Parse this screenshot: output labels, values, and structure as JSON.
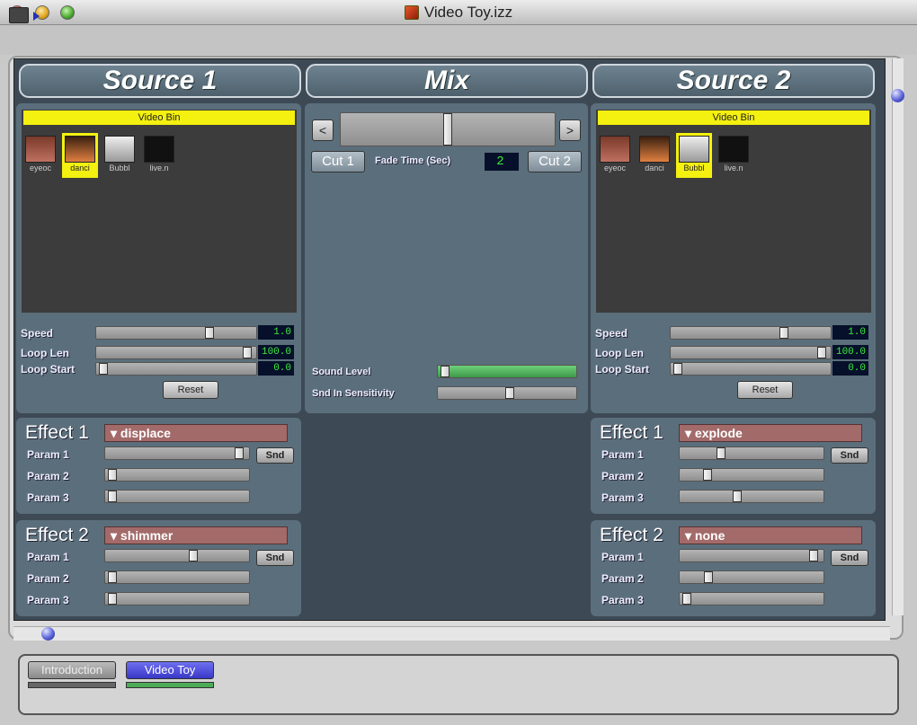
{
  "window": {
    "title": "Video Toy.izz"
  },
  "sources": [
    {
      "header": "Source 1",
      "bin_label": "Video Bin",
      "clips": [
        {
          "name": "eyeoc",
          "sel": false
        },
        {
          "name": "danci",
          "sel": true
        },
        {
          "name": "Bubbl",
          "sel": false
        },
        {
          "name": "live.n",
          "sel": false
        }
      ],
      "speed_label": "Speed",
      "speed_value": "1.0",
      "speed_level": 0.72,
      "looplen_label": "Loop Len",
      "looplen_value": "100.0",
      "looplen_level": 0.97,
      "loopstart_label": "Loop Start",
      "loopstart_value": "0.0",
      "loopstart_level": 0.02,
      "reset_label": "Reset",
      "effect1": {
        "title": "Effect 1",
        "name": "displace",
        "p1_label": "Param 1",
        "p1": 0.96,
        "p2_label": "Param 2",
        "p2": 0.02,
        "p3_label": "Param 3",
        "p3": 0.02,
        "snd_label": "Snd"
      },
      "effect2": {
        "title": "Effect 2",
        "name": "shimmer",
        "p1_label": "Param 1",
        "p1": 0.62,
        "p2_label": "Param 2",
        "p2": 0.02,
        "p3_label": "Param 3",
        "p3": 0.02,
        "snd_label": "Snd"
      }
    },
    {
      "header": "Source 2",
      "bin_label": "Video Bin",
      "clips": [
        {
          "name": "eyeoc",
          "sel": false
        },
        {
          "name": "danci",
          "sel": false
        },
        {
          "name": "Bubbl",
          "sel": true
        },
        {
          "name": "live.n",
          "sel": false
        }
      ],
      "speed_label": "Speed",
      "speed_value": "1.0",
      "speed_level": 0.72,
      "looplen_label": "Loop Len",
      "looplen_value": "100.0",
      "looplen_level": 0.97,
      "loopstart_label": "Loop Start",
      "loopstart_value": "0.0",
      "loopstart_level": 0.02,
      "reset_label": "Reset",
      "effect1": {
        "title": "Effect 1",
        "name": "explode",
        "p1_label": "Param 1",
        "p1": 0.27,
        "p2_label": "Param 2",
        "p2": 0.17,
        "p3_label": "Param 3",
        "p3": 0.39,
        "snd_label": "Snd"
      },
      "effect2": {
        "title": "Effect 2",
        "name": "none",
        "p1_label": "Param 1",
        "p1": 0.96,
        "p2_label": "Param 2",
        "p2": 0.18,
        "p3_label": "Param 3",
        "p3": 0.02,
        "snd_label": "Snd"
      }
    }
  ],
  "mix": {
    "header": "Mix",
    "left_arrow": "<",
    "right_arrow": ">",
    "crossfade_level": 0.5,
    "cut1_label": "Cut 1",
    "cut2_label": "Cut 2",
    "fade_label": "Fade Time (Sec)",
    "fade_value": "2",
    "sound_level_label": "Sound Level",
    "sound_level": 0.02,
    "snd_sens_label": "Snd In Sensitivity",
    "snd_sens": 0.52
  },
  "tabs": [
    {
      "label": "Introduction",
      "active": false
    },
    {
      "label": "Video Toy",
      "active": true
    }
  ],
  "colors": {
    "accent_yellow": "#f4f010",
    "lcd_green": "#3eea3e",
    "dropdown_red": "#a36a6a",
    "sound_green": "#4caa58",
    "tab_active": "#4a4ae0"
  },
  "icons": {
    "window": "document-icon",
    "toolbar": "editor-toolbar-icon"
  }
}
